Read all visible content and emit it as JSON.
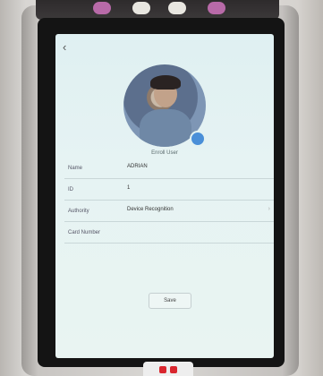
{
  "screen": {
    "back_icon": "chevron-left-icon",
    "caption": "Enroll User",
    "fields": [
      {
        "label": "Name",
        "value": "ADRIAN"
      },
      {
        "label": "ID",
        "value": "1"
      },
      {
        "label": "Authority",
        "value": "Device Recognition"
      },
      {
        "label": "Card Number",
        "value": ""
      }
    ],
    "save_label": "Save"
  }
}
